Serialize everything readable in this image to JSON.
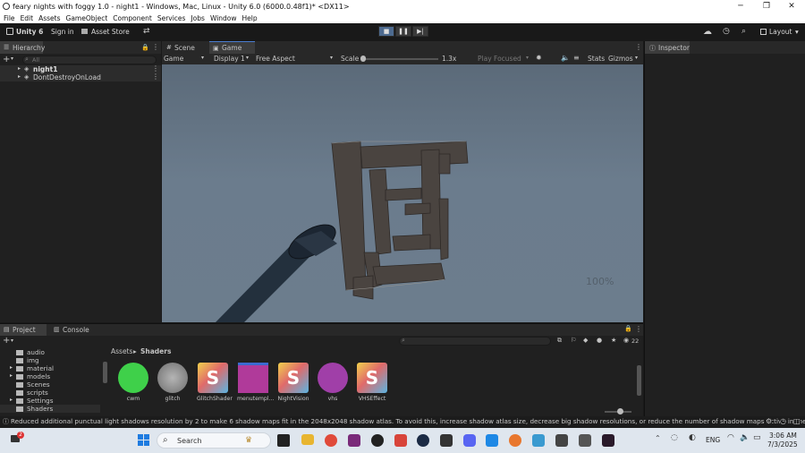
{
  "window": {
    "title": "feary nights with foggy 1.0 - night1 - Windows, Mac, Linux - Unity 6.0 (6000.0.48f1)* <DX11>",
    "minimize": "─",
    "maximize": "❐",
    "close": "✕"
  },
  "menu": [
    "File",
    "Edit",
    "Assets",
    "GameObject",
    "Component",
    "Services",
    "Jobs",
    "Window",
    "Help"
  ],
  "toolbar": {
    "account": "Unity 6",
    "sign_in": "Sign in",
    "asset_store": "Asset Store",
    "layout": "Layout"
  },
  "hierarchy": {
    "tab": "Hierarchy",
    "search_placeholder": "All",
    "items": [
      {
        "label": "night1"
      },
      {
        "label": "DontDestroyOnLoad"
      }
    ]
  },
  "scene_tabs": {
    "scene": "Scene",
    "game": "Game"
  },
  "game_toolbar": {
    "mode": "Game",
    "display": "Display 1",
    "aspect": "Free Aspect",
    "scale_label": "Scale",
    "scale_value": "1.3x",
    "play_focused": "Play Focused",
    "stats": "Stats",
    "gizmos": "Gizmos"
  },
  "game_view": {
    "overlay_text": "100%"
  },
  "inspector": {
    "tab": "Inspector"
  },
  "project": {
    "tab_project": "Project",
    "tab_console": "Console",
    "folders": [
      "audio",
      "img",
      "material",
      "models",
      "Scenes",
      "scripts",
      "Settings",
      "Shaders"
    ],
    "breadcrumb": {
      "root": "Assets",
      "sep": "▸",
      "current": "Shaders"
    },
    "assets": [
      {
        "name": "cwm",
        "kind": "material",
        "color": "#3fd04a"
      },
      {
        "name": "glitch",
        "kind": "material",
        "color": "#9a9a9a"
      },
      {
        "name": "GlitchShader",
        "kind": "shader"
      },
      {
        "name": "menutempl...",
        "kind": "texture",
        "color": "#b03a9a"
      },
      {
        "name": "NightVision",
        "kind": "shader"
      },
      {
        "name": "vhs",
        "kind": "material",
        "color": "#a03fa8"
      },
      {
        "name": "VHSEffect",
        "kind": "shader"
      }
    ],
    "count": "22"
  },
  "status": {
    "message": "Reduced additional punctual light shadows resolution by 2 to make 6 shadow maps fit in the 2048x2048 shadow atlas. To avoid this, increase shadow atlas size, decrease big shadow resolutions, or reduce the number of shadow maps active in the"
  },
  "taskbar": {
    "search": "Search",
    "notification_count": "2",
    "language": "ENG",
    "time": "3:06 AM",
    "date": "7/3/2025"
  }
}
